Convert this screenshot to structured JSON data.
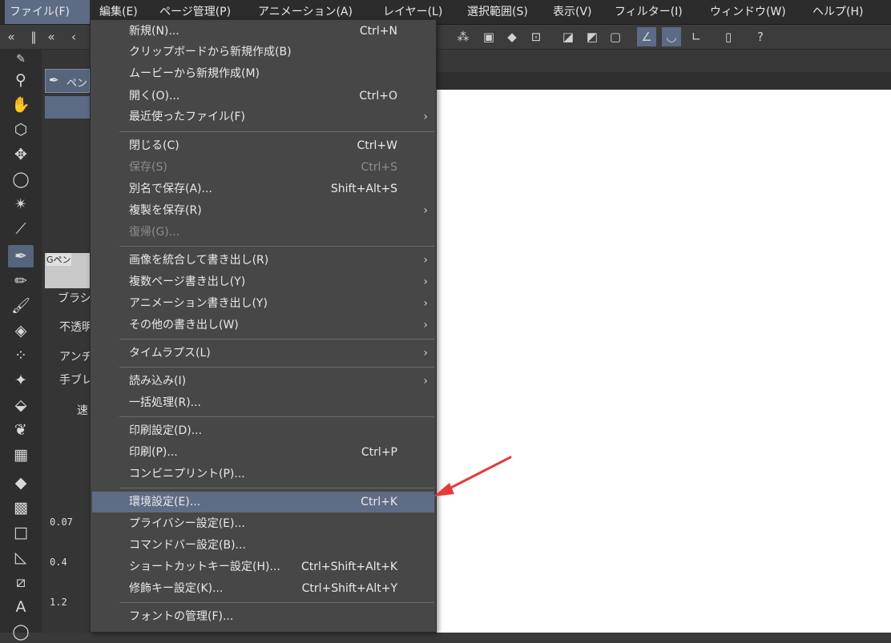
{
  "menubar": {
    "items": [
      {
        "label": "ファイル(F)",
        "active": true
      },
      {
        "label": "編集(E)"
      },
      {
        "label": "ページ管理(P)"
      },
      {
        "label": "アニメーション(A)"
      },
      {
        "label": "レイヤー(L)"
      },
      {
        "label": "選択範囲(S)"
      },
      {
        "label": "表示(V)"
      },
      {
        "label": "フィルター(I)"
      },
      {
        "label": "ウィンドウ(W)"
      },
      {
        "label": "ヘルプ(H)"
      }
    ]
  },
  "file_menu": {
    "items": [
      {
        "label": "新規(N)...",
        "shortcut": "Ctrl+N"
      },
      {
        "label": "クリップボードから新規作成(B)"
      },
      {
        "label": "ムービーから新規作成(M)"
      },
      {
        "label": "開く(O)...",
        "shortcut": "Ctrl+O"
      },
      {
        "label": "最近使ったファイル(F)",
        "submenu": true
      },
      {
        "label": "閉じる(C)",
        "shortcut": "Ctrl+W"
      },
      {
        "label": "保存(S)",
        "shortcut": "Ctrl+S",
        "disabled": true
      },
      {
        "label": "別名で保存(A)...",
        "shortcut": "Shift+Alt+S"
      },
      {
        "label": "複製を保存(R)",
        "submenu": true
      },
      {
        "label": "復帰(G)...",
        "disabled": true
      },
      {
        "label": "画像を統合して書き出し(R)",
        "submenu": true
      },
      {
        "label": "複数ページ書き出し(Y)",
        "submenu": true
      },
      {
        "label": "アニメーション書き出し(Y)",
        "submenu": true
      },
      {
        "label": "その他の書き出し(W)",
        "submenu": true
      },
      {
        "label": "タイムラプス(L)",
        "submenu": true
      },
      {
        "label": "読み込み(I)",
        "submenu": true
      },
      {
        "label": "一括処理(R)..."
      },
      {
        "label": "印刷設定(D)..."
      },
      {
        "label": "印刷(P)...",
        "shortcut": "Ctrl+P"
      },
      {
        "label": "コンビニプリント(P)..."
      },
      {
        "label": "環境設定(E)...",
        "shortcut": "Ctrl+K",
        "highlighted": true
      },
      {
        "label": "プライバシー設定(E)..."
      },
      {
        "label": "コマンドバー設定(B)..."
      },
      {
        "label": "ショートカットキー設定(H)...",
        "shortcut": "Ctrl+Shift+Alt+K"
      },
      {
        "label": "修飾キー設定(K)...",
        "shortcut": "Ctrl+Shift+Alt+Y"
      },
      {
        "label": "フォントの管理(F)..."
      }
    ]
  },
  "sub_tool_panel": {
    "pen_label": "ペン",
    "brush_name": "Gペン",
    "props": [
      "ブラシ",
      "不透明",
      "アンチ",
      "手ブレ",
      "速"
    ],
    "brush_sizes": [
      "0.07",
      "0.4",
      "1.2"
    ]
  },
  "colors": {
    "menu_bg": "#474747",
    "highlight": "#5f6c86",
    "annotation_arrow": "#e8393a"
  }
}
